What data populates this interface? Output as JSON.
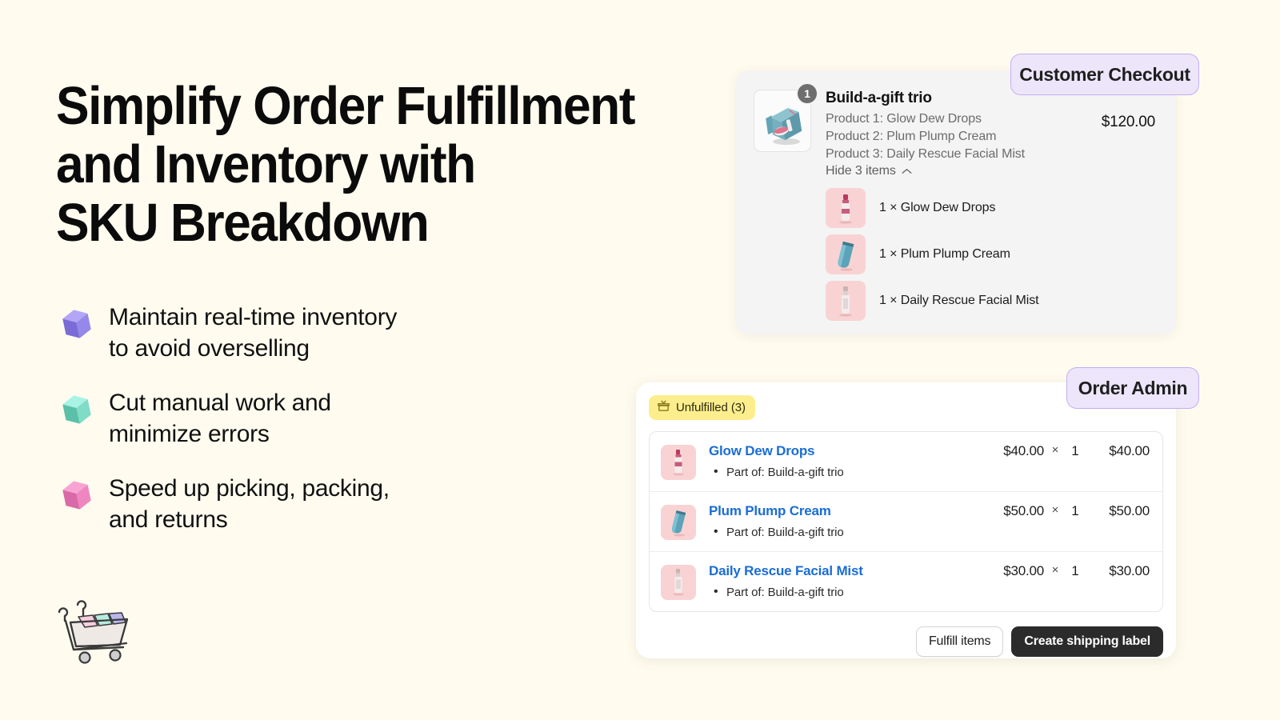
{
  "hero": {
    "headline": "Simplify Order Fulfillment\nand Inventory with\nSKU Breakdown",
    "bullets": [
      {
        "text": "Maintain real-time inventory\nto avoid overselling",
        "color": "#9b8cf0"
      },
      {
        "text": "Cut manual work and\nminimize errors",
        "color": "#7fd9c4"
      },
      {
        "text": "Speed up picking, packing,\nand returns",
        "color": "#f07fc0"
      }
    ]
  },
  "labels": {
    "customer_checkout": "Customer Checkout",
    "order_admin": "Order Admin"
  },
  "checkout": {
    "quantity_badge": "1",
    "title": "Build-a-gift trio",
    "components": [
      "Product 1: Glow Dew Drops",
      "Product 2: Plum Plump Cream",
      "Product 3: Daily Rescue Facial Mist"
    ],
    "toggle_label": "Hide 3 items",
    "price": "$120.00",
    "children": [
      {
        "label": "1 × Glow Dew Drops"
      },
      {
        "label": "1 × Plum Plump Cream"
      },
      {
        "label": "1 × Daily Rescue Facial Mist"
      }
    ]
  },
  "admin": {
    "status_badge": "Unfulfilled (3)",
    "lines": [
      {
        "name": "Glow Dew Drops",
        "part_of": "Part of: Build-a-gift trio",
        "unit_price": "$40.00",
        "times": "×",
        "quantity": "1",
        "total": "$40.00"
      },
      {
        "name": "Plum Plump Cream",
        "part_of": "Part of: Build-a-gift trio",
        "unit_price": "$50.00",
        "times": "×",
        "quantity": "1",
        "total": "$50.00"
      },
      {
        "name": "Daily Rescue Facial Mist",
        "part_of": "Part of: Build-a-gift trio",
        "unit_price": "$30.00",
        "times": "×",
        "quantity": "1",
        "total": "$30.00"
      }
    ],
    "fulfill_button": "Fulfill items",
    "shipping_button": "Create shipping label"
  },
  "colors": {
    "background": "#FFFCEF",
    "pill_bg": "#EDE6FB",
    "pill_border": "#C2AEF0",
    "badge_yellow": "#FCEE8D",
    "link_blue": "#1A6DD4",
    "thumb_pink": "#F9D3D3",
    "primary_button": "#2B2B2B"
  }
}
